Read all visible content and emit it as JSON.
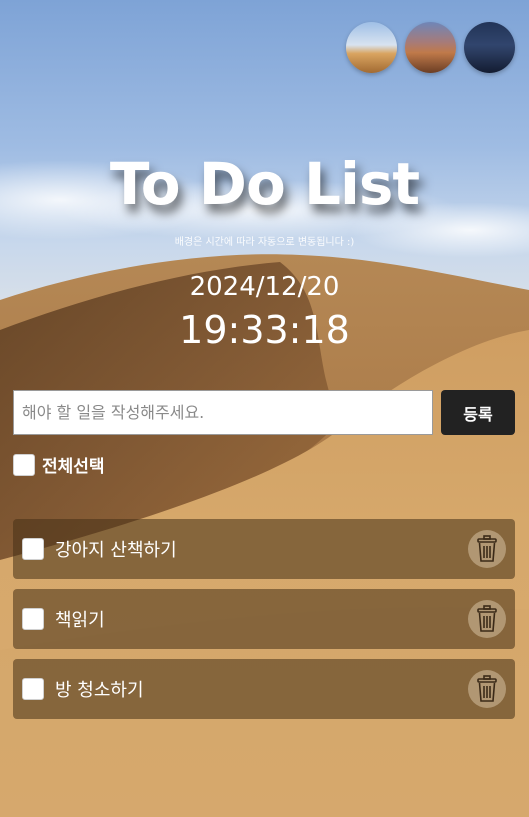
{
  "themes": [
    {
      "name": "day"
    },
    {
      "name": "sunset"
    },
    {
      "name": "night"
    }
  ],
  "title": "To Do List",
  "subtitle": "배경은 시간에 따라 자동으로 변동됩니다 :)",
  "date": "2024/12/20",
  "time": "19:33:18",
  "input": {
    "placeholder": "해야 할 일을 작성해주세요.",
    "value": ""
  },
  "submit_label": "등록",
  "select_all_label": "전체선택",
  "todos": [
    {
      "text": "강아지 산책하기",
      "checked": false
    },
    {
      "text": "책읽기",
      "checked": false
    },
    {
      "text": "방 청소하기",
      "checked": false
    }
  ],
  "icons": {
    "delete": "trash-icon"
  }
}
